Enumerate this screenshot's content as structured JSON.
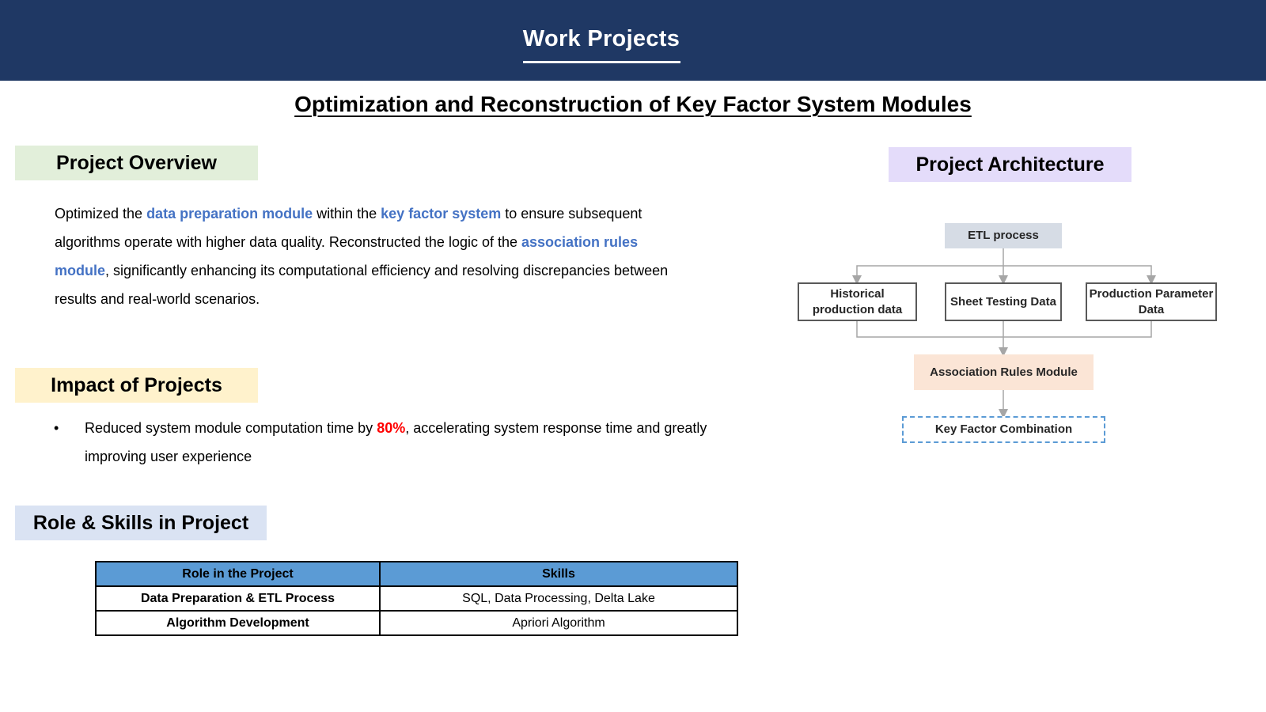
{
  "header": {
    "title": "Work Projects"
  },
  "main_title": "Optimization and Reconstruction of Key Factor System Modules",
  "overview": {
    "label": "Project Overview",
    "t1": "Optimized the ",
    "h1": "data preparation module",
    "t2": " within the ",
    "h2": "key factor system",
    "t3": " to ensure subsequent algorithms operate with higher data quality. Reconstructed the logic of the ",
    "h3": "association rules module",
    "t4": ", significantly enhancing its computational efficiency and resolving discrepancies between results and real-world scenarios."
  },
  "impact": {
    "label": "Impact of Projects",
    "bullet": "•",
    "t1": "Reduced system module computation time by ",
    "value": "80%",
    "t2": ", accelerating system response time and greatly improving user experience"
  },
  "role": {
    "label": "Role & Skills in Project",
    "headers": [
      "Role in the Project",
      "Skills"
    ],
    "rows": [
      [
        "Data Preparation & ETL Process",
        "SQL, Data Processing, Delta Lake"
      ],
      [
        "Algorithm Development",
        "Apriori Algorithm"
      ]
    ]
  },
  "architecture": {
    "label": "Project Architecture",
    "etl": "ETL process",
    "sources": [
      "Historical production data",
      "Sheet Testing Data",
      "Production Parameter Data"
    ],
    "module": "Association Rules Module",
    "output": "Key Factor Combination"
  },
  "colors": {
    "header_bg": "#1f3864",
    "highlight_blue": "#4472c4",
    "highlight_red": "#ff0000",
    "table_header": "#5b9bd5"
  }
}
